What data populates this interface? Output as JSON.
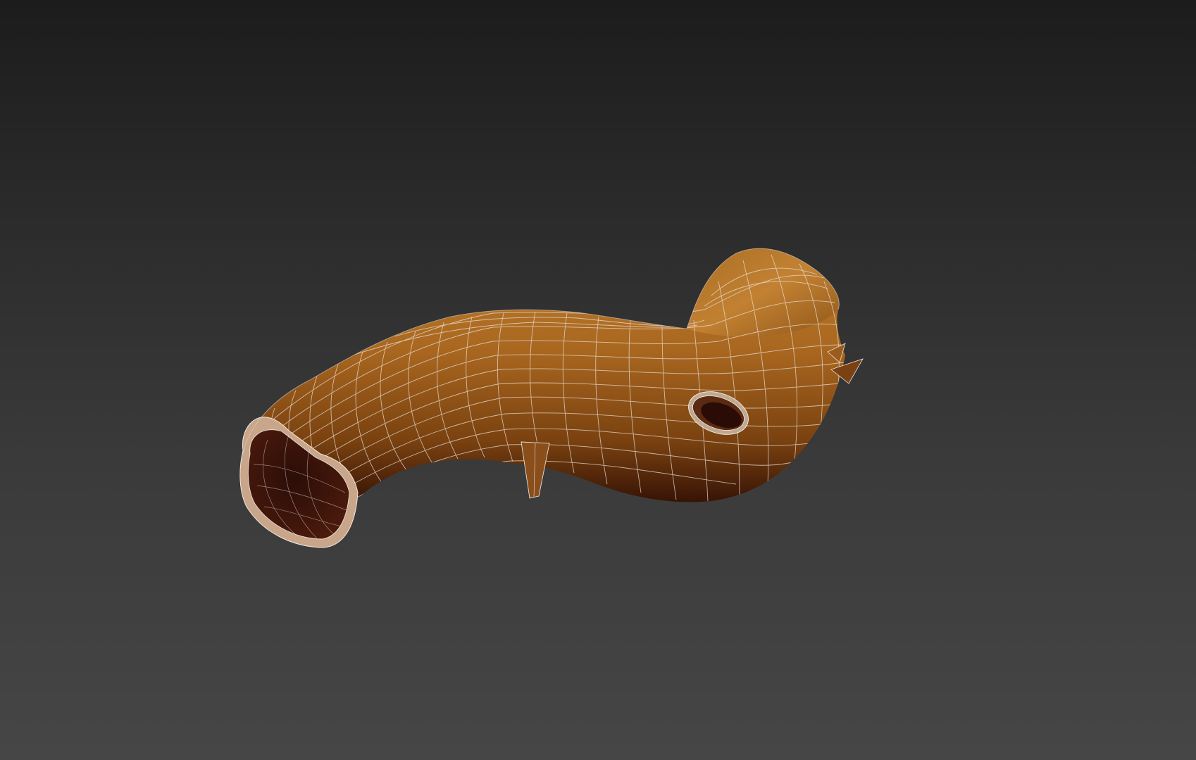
{
  "viewport": {
    "background_top": "#1c1c1c",
    "background_bottom": "#464646",
    "shading_mode": "edged-faces"
  },
  "model": {
    "object": "bent-pipe-mesh",
    "material_light": "#b8782a",
    "material_mid": "#8a5217",
    "material_dark": "#2a0e04",
    "wire_color": "#e8e0d8"
  }
}
